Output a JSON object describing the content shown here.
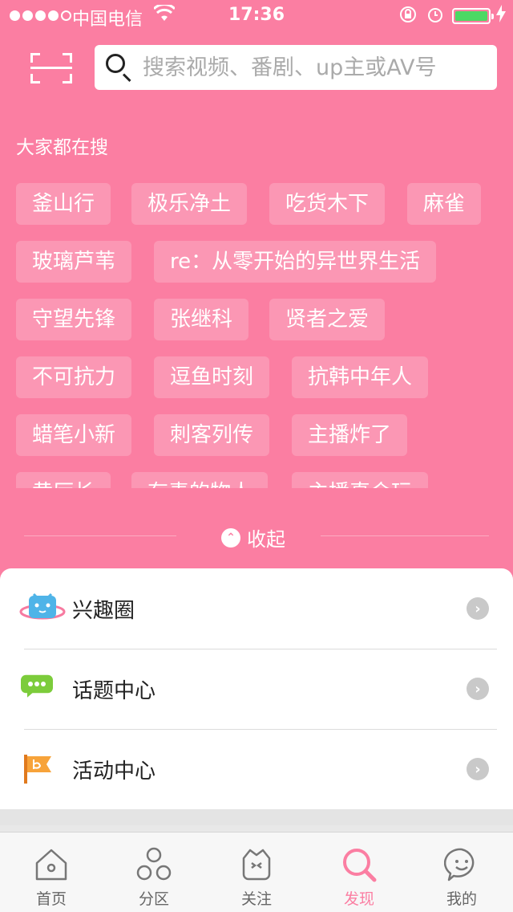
{
  "status_bar": {
    "carrier": "中国电信",
    "time": "17:36",
    "wifi_icon": "wifi-icon",
    "battery_color": "#4cd964"
  },
  "search": {
    "placeholder": "搜索视频、番剧、up主或AV号",
    "value": ""
  },
  "hot_search": {
    "title": "大家都在搜",
    "tags": [
      "釜山行",
      "极乐净土",
      "吃货木下",
      "麻雀",
      "玻璃芦苇",
      "re：从零开始的异世界生活",
      "守望先锋",
      "张继科",
      "贤者之爱",
      "不可抗力",
      "逗鱼时刻",
      "抗韩中年人",
      "蜡笔小新",
      "刺客列传",
      "主播炸了",
      "黄厅长",
      "有毒的物人",
      "主播真会玩"
    ],
    "collapse_label": "收起"
  },
  "menu": [
    {
      "label": "兴趣圈",
      "icon": "tv-planet-icon"
    },
    {
      "label": "话题中心",
      "icon": "chat-bubble-icon"
    },
    {
      "label": "活动中心",
      "icon": "flag-icon"
    }
  ],
  "tabbar": {
    "items": [
      {
        "label": "首页",
        "icon": "home-icon"
      },
      {
        "label": "分区",
        "icon": "category-icon"
      },
      {
        "label": "关注",
        "icon": "follow-icon"
      },
      {
        "label": "发现",
        "icon": "discover-icon",
        "active": true
      },
      {
        "label": "我的",
        "icon": "profile-icon"
      }
    ]
  },
  "colors": {
    "accent": "#fb7ea2",
    "tag_bg": "rgba(255,255,255,0.2)"
  }
}
